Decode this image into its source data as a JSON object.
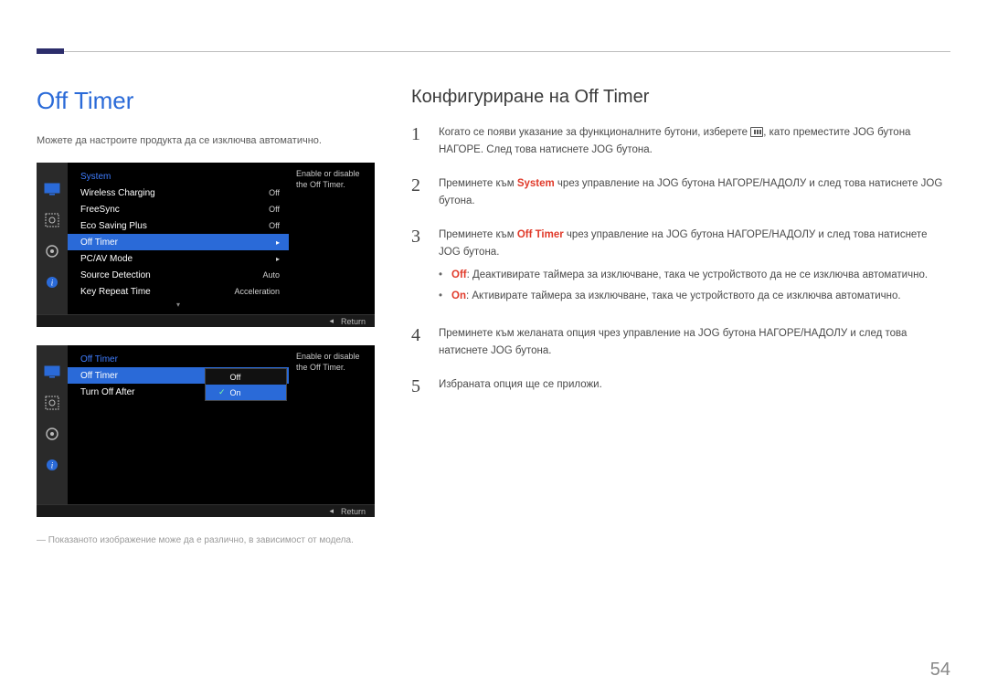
{
  "page_number": "54",
  "left": {
    "heading": "Off Timer",
    "intro": "Можете да настроите продукта да се изключва автоматично.",
    "note": "― Показаното изображение може да е различно, в зависимост от модела."
  },
  "osd1": {
    "sidebar_icons": [
      "monitor-icon",
      "picture-icon",
      "gear-icon",
      "info-icon"
    ],
    "title": "System",
    "rows": [
      {
        "label": "Wireless Charging",
        "value": "Off",
        "selected": false,
        "chev": false
      },
      {
        "label": "FreeSync",
        "value": "Off",
        "selected": false,
        "chev": false
      },
      {
        "label": "Eco Saving Plus",
        "value": "Off",
        "selected": false,
        "chev": false
      },
      {
        "label": "Off Timer",
        "value": "",
        "selected": true,
        "chev": true
      },
      {
        "label": "PC/AV Mode",
        "value": "",
        "selected": false,
        "chev": true
      },
      {
        "label": "Source Detection",
        "value": "Auto",
        "selected": false,
        "chev": false
      },
      {
        "label": "Key Repeat Time",
        "value": "Acceleration",
        "selected": false,
        "chev": false
      }
    ],
    "help_text": "Enable or disable the Off Timer.",
    "footer_arrow": "◂",
    "footer_label": "Return"
  },
  "osd2": {
    "sidebar_icons": [
      "monitor-icon",
      "picture-icon",
      "gear-icon",
      "info-icon"
    ],
    "title": "Off Timer",
    "rows": [
      {
        "label": "Off Timer",
        "value": "Off",
        "selected": true,
        "chev": false
      },
      {
        "label": "Turn Off After",
        "value": "",
        "selected": false,
        "chev": false
      }
    ],
    "popup": {
      "items": [
        "Off",
        "On"
      ],
      "selected_index": 1
    },
    "help_text": "Enable or disable the Off Timer.",
    "footer_arrow": "◂",
    "footer_label": "Return"
  },
  "right": {
    "heading": "Конфигуриране на Off Timer",
    "steps": [
      {
        "n": "1",
        "html": "Когато се появи указание за функционалните бутони, изберете {icon}, като преместите JOG бутона НАГОРЕ. След това натиснете JOG бутона."
      },
      {
        "n": "2",
        "pre": "Преминете към ",
        "kw": "System",
        "post": " чрез управление на JOG бутона НАГОРЕ/НАДОЛУ и след това натиснете JOG бутона.",
        "kw_class": "red"
      },
      {
        "n": "3",
        "pre": "Преминете към ",
        "kw": "Off Timer",
        "post": " чрез управление на JOG бутона НАГОРЕ/НАДОЛУ и след това натиснете JOG бутона.",
        "kw_class": "red",
        "bullets": [
          {
            "kw": "Off",
            "text": ": Деактивирате таймера за изключване, така че устройството да не се изключва автоматично."
          },
          {
            "kw": "On",
            "text": ": Активирате таймера за изключване, така че устройството да се изключва автоматично."
          }
        ]
      },
      {
        "n": "4",
        "text": "Преминете към желаната опция чрез управление на JOG бутона НАГОРЕ/НАДОЛУ и след това натиснете JOG бутона."
      },
      {
        "n": "5",
        "text": "Избраната опция ще се приложи."
      }
    ]
  }
}
